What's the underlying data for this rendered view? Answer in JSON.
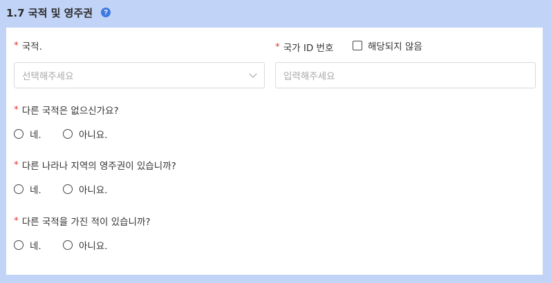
{
  "section": {
    "title": "1.7 국적 및 영주권",
    "help_icon": "?"
  },
  "required_marker": "*",
  "fields": {
    "nationality": {
      "label": "국적.",
      "placeholder": "선택해주세요"
    },
    "national_id": {
      "label": "국가 ID 번호",
      "placeholder": "입력해주세요",
      "not_applicable_label": "해당되지 않음"
    }
  },
  "questions": [
    {
      "label": "다른 국적은 없으신가요?",
      "yes": "네.",
      "no": "아니요."
    },
    {
      "label": "다른 나라나 지역의 영주권이 있습니까?",
      "yes": "네.",
      "no": "아니요."
    },
    {
      "label": "다른 국적을 가진 적이 있습니까?",
      "yes": "네.",
      "no": "아니요."
    }
  ],
  "colors": {
    "background": "#c1d4f7",
    "required": "#e1382c",
    "help_icon": "#3d79e0"
  }
}
